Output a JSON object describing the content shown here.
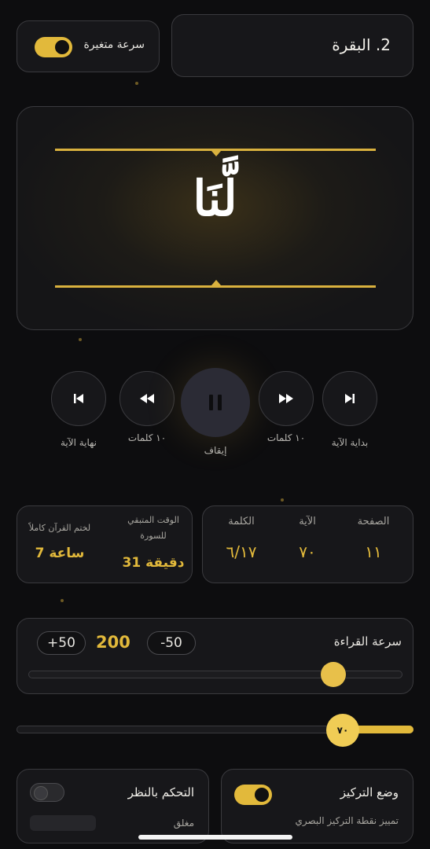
{
  "header": {
    "surah_title": "2. البقرة",
    "speed_toggle_label": "سرعة متغيرة",
    "speed_toggle_on": true
  },
  "display": {
    "current_word": "لَّنَا"
  },
  "controls": {
    "verse_end_label": "نهاية الآية",
    "back10_label": "١٠ كلمات",
    "pause_label": "إيقاف",
    "fwd10_label": "١٠ كلمات",
    "verse_start_label": "بداية الآية"
  },
  "stats": {
    "page_label": "الصفحة",
    "page_value": "١١",
    "verse_label": "الآية",
    "verse_value": "٧٠",
    "word_label": "الكلمة",
    "word_value": "٦/١٧"
  },
  "time": {
    "surah_remaining_label_1": "الوقت المتبقي",
    "surah_remaining_label_2": "للسورة",
    "surah_remaining_value": "31 دقيقة",
    "quran_complete_label": "لختم القرآن كاملاً",
    "quran_complete_value": "7 ساعة"
  },
  "reading_speed": {
    "title": "سرعة القراءة",
    "minus_label": "-50",
    "plus_label": "+50",
    "value": "200",
    "slider_fraction": 0.82
  },
  "verse_slider": {
    "thumb_label": "٧٠"
  },
  "focus_mode": {
    "title": "وضع التركيز",
    "subtitle": "تمييز نقطة التركيز البصري",
    "enabled": true
  },
  "gaze_control": {
    "title": "التحكم بالنظر",
    "subtitle": "مغلق",
    "enabled": false
  },
  "colors": {
    "accent": "#e2b93b",
    "background": "#0d0d0f",
    "card": "#17171a"
  }
}
